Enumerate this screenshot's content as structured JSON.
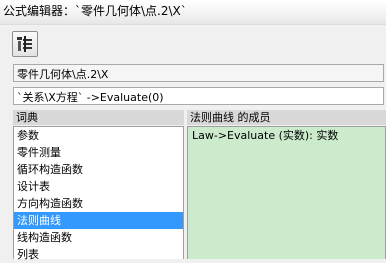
{
  "window": {
    "title": "公式编辑器：`零件几何体\\点.2\\X`"
  },
  "toolbar": {
    "icon": "formula-browser-icon"
  },
  "parameter_field": {
    "value": "零件几何体\\点.2\\X"
  },
  "formula_input": {
    "value": "`关系\\X方程` ->Evaluate(0)"
  },
  "dictionary": {
    "header": "词典",
    "items": [
      "参数",
      "零件测量",
      "循环构造函数",
      "设计表",
      "方向构造函数",
      "法则曲线",
      "线构造函数",
      "列表"
    ],
    "selected": "法则曲线"
  },
  "members": {
    "header": "法则曲线 的成员",
    "items": [
      "Law->Evaluate (实数): 实数"
    ]
  }
}
